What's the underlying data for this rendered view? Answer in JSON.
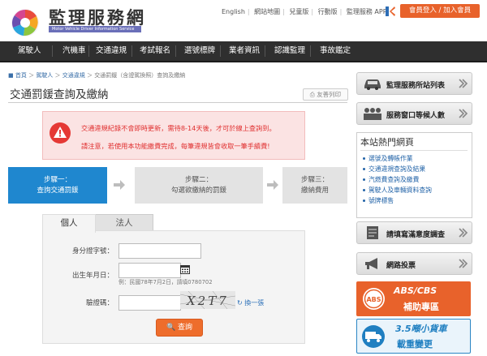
{
  "header": {
    "site_title": "監理服務網",
    "site_subtitle": "Motor Vehicle Driver Information Service",
    "links": [
      "English",
      "網站地圖",
      "兒童版",
      "行動版",
      "監理服務 APP"
    ],
    "login_label": "會員登入 / 加入會員"
  },
  "nav": {
    "items": [
      "駕駛人",
      "汽機車",
      "交通違規",
      "考試報名",
      "選號標牌",
      "業者資訊",
      "認識監理",
      "事故鑑定"
    ]
  },
  "breadcrumb": {
    "home": "首頁",
    "items": [
      "駕駛人",
      "交通違規",
      "交通罰鍰（含證駕換照）查詢及繳納"
    ]
  },
  "page": {
    "title": "交通罰鍰查詢及繳納",
    "print_label": "友善列印"
  },
  "notice": {
    "line1": "交通違規紀錄不會即時更新，需待8-14天後，才可於線上查詢到。",
    "line2": "請注意，若使用本功能繳費完成，每筆違規皆會收取一筆手續費!"
  },
  "steps": [
    {
      "title": "步驟一：",
      "desc": "查詢交通罰鍰"
    },
    {
      "title": "步驟二：",
      "desc": "勾選欲繳納的罰鍰"
    },
    {
      "title": "步驟三：",
      "desc": "繳納費用"
    }
  ],
  "tabs": [
    "個人",
    "法人"
  ],
  "form": {
    "id_label": "身分證字號：",
    "id_value": "",
    "dob_label": "出生年月日：",
    "dob_value": "",
    "dob_hint": "例：民國78年7月2日，請填0780702",
    "captcha_label": "驗證碼：",
    "captcha_value": "",
    "captcha_text": "X2T7",
    "refresh_label": "換一張",
    "search_label": "查詢"
  },
  "sidebar": {
    "buttons": [
      "監理服務所站列表",
      "服務窗口等候人數",
      "請填寫滿意度調查",
      "網路投票"
    ],
    "hot_title": "本站熱門網頁",
    "hot_items": [
      "選號及轉帳作業",
      "交通違規查詢及結果",
      "汽燃費查詢及繳費",
      "駕駛人及車輛資料查詢",
      "號牌標售"
    ],
    "abs_badge": "ABS",
    "abs_line1": "ABS/CBS",
    "abs_line2": "補助專區",
    "truck_line1": "3.5噸小貨車",
    "truck_line2": "載重變更"
  },
  "colors": {
    "accent": "#e8622b",
    "nav_bg": "#2f2f2f",
    "step_active": "#1f87cf",
    "notice_text": "#e03030"
  }
}
